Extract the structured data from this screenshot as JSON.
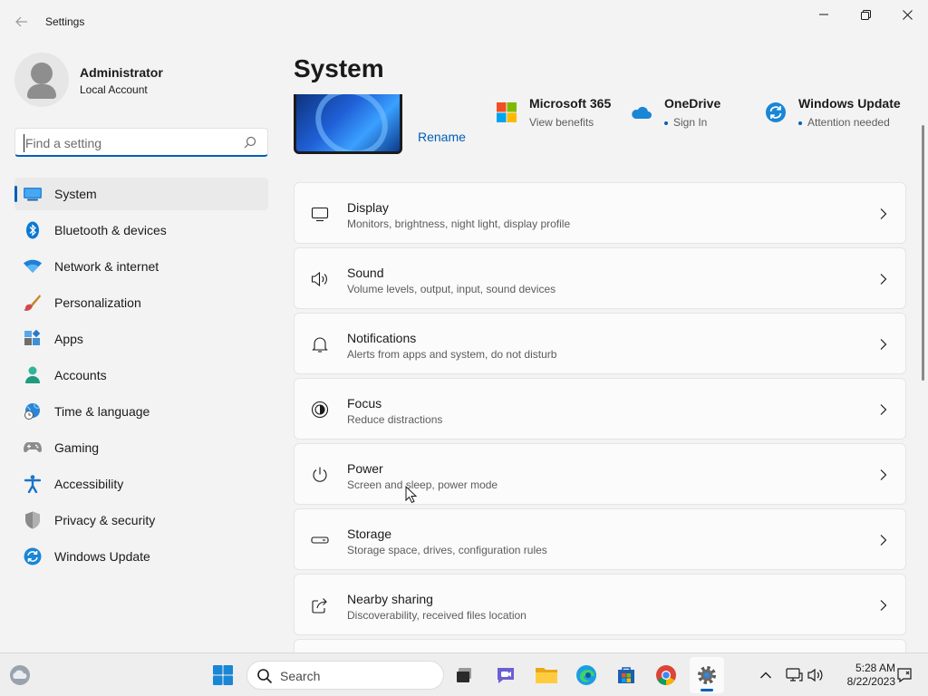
{
  "window": {
    "app_title": "Settings"
  },
  "profile": {
    "name": "Administrator",
    "account_type": "Local Account"
  },
  "search": {
    "placeholder": "Find a setting"
  },
  "sidebar": {
    "items": [
      {
        "label": "System",
        "icon": "monitor-icon",
        "selected": true
      },
      {
        "label": "Bluetooth & devices",
        "icon": "bluetooth-icon",
        "selected": false
      },
      {
        "label": "Network & internet",
        "icon": "wifi-icon",
        "selected": false
      },
      {
        "label": "Personalization",
        "icon": "paintbrush-icon",
        "selected": false
      },
      {
        "label": "Apps",
        "icon": "apps-icon",
        "selected": false
      },
      {
        "label": "Accounts",
        "icon": "person-icon",
        "selected": false
      },
      {
        "label": "Time & language",
        "icon": "globe-clock-icon",
        "selected": false
      },
      {
        "label": "Gaming",
        "icon": "gamepad-icon",
        "selected": false
      },
      {
        "label": "Accessibility",
        "icon": "accessibility-icon",
        "selected": false
      },
      {
        "label": "Privacy & security",
        "icon": "shield-icon",
        "selected": false
      },
      {
        "label": "Windows Update",
        "icon": "update-icon",
        "selected": false
      }
    ]
  },
  "main": {
    "title": "System",
    "rename_label": "Rename",
    "tiles": [
      {
        "title": "Microsoft 365",
        "subtitle": "View benefits",
        "icon": "microsoft-logo-icon"
      },
      {
        "title": "OneDrive",
        "subtitle": "Sign In",
        "icon": "onedrive-cloud-icon"
      },
      {
        "title": "Windows Update",
        "subtitle": "Attention needed",
        "icon": "windows-update-icon"
      }
    ],
    "cards": [
      {
        "title": "Display",
        "subtitle": "Monitors, brightness, night light, display profile",
        "icon": "display-icon"
      },
      {
        "title": "Sound",
        "subtitle": "Volume levels, output, input, sound devices",
        "icon": "speaker-icon"
      },
      {
        "title": "Notifications",
        "subtitle": "Alerts from apps and system, do not disturb",
        "icon": "bell-icon"
      },
      {
        "title": "Focus",
        "subtitle": "Reduce distractions",
        "icon": "focus-icon"
      },
      {
        "title": "Power",
        "subtitle": "Screen and sleep, power mode",
        "icon": "power-icon"
      },
      {
        "title": "Storage",
        "subtitle": "Storage space, drives, configuration rules",
        "icon": "storage-icon"
      },
      {
        "title": "Nearby sharing",
        "subtitle": "Discoverability, received files location",
        "icon": "share-icon"
      }
    ]
  },
  "taskbar": {
    "search_label": "Search",
    "time": "5:28 AM",
    "date": "8/22/2023"
  },
  "colors": {
    "accent": "#005fb8",
    "background": "#f3f3f3",
    "card": "#fbfbfb"
  }
}
